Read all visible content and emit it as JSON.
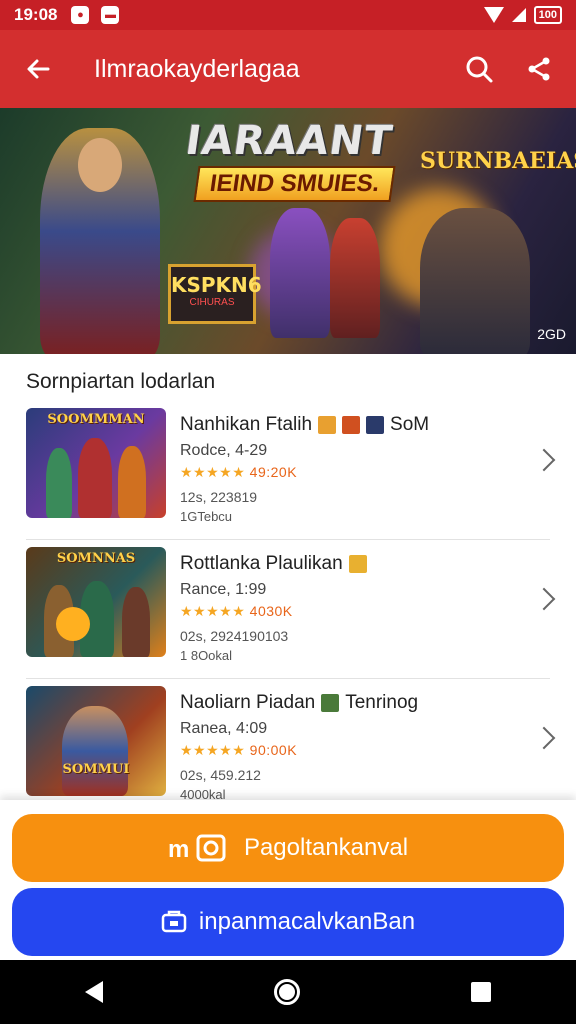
{
  "status_bar": {
    "time": "19:08",
    "battery": "100"
  },
  "app_bar": {
    "title": "Ilmraokayderlagaa"
  },
  "banner": {
    "title": "IARAANT",
    "subtitle": "IEIND SMUIES.",
    "right_title": "SURNBAEIAS",
    "badge_title": "KSPKN6",
    "badge_subtitle": "CIHURAS",
    "year": "2GD"
  },
  "section": {
    "title": "Sornpiartan lodarlan"
  },
  "games": [
    {
      "thumb_label": "SOOMMMAN",
      "name": "Nanhikan Ftalih",
      "name_suffix": "SoM",
      "meta": "Rodce, 4-29",
      "stars": "★★★★★",
      "rating": "49:20K",
      "downloads": "12s, 223819",
      "size": "1GTebcu",
      "colors": [
        "#2b3c7a",
        "#6a3aa0",
        "#c8402a"
      ]
    },
    {
      "thumb_label": "SOMNNAS",
      "name": "Rottlanka Plaulikan",
      "name_suffix": "",
      "meta": "Rance, 1:99",
      "stars": "★★★★★",
      "rating": "4030K",
      "downloads": "02s, 2924190103",
      "size": "1 8Ookal",
      "colors": [
        "#5a3a1a",
        "#2a5a5a",
        "#e0801a"
      ]
    },
    {
      "thumb_label": "SOMMUI",
      "name": "Naoliarn Piadan",
      "name_suffix": "Tenrinog",
      "meta": "Ranea, 4:09",
      "stars": "★★★★★",
      "rating": "90:00K",
      "downloads": "02s, 459.212",
      "size": "4000kal",
      "colors": [
        "#1a4a6a",
        "#a04020",
        "#e0b040"
      ]
    }
  ],
  "buttons": {
    "primary": "Pagoltankanval",
    "secondary": "inpanmacalvkanBan"
  },
  "colors": {
    "app_bar": "#d32f2f",
    "status_bar": "#c62026",
    "button_primary": "#f7900f",
    "button_secondary": "#2547f0",
    "rating": "#e8651a"
  }
}
